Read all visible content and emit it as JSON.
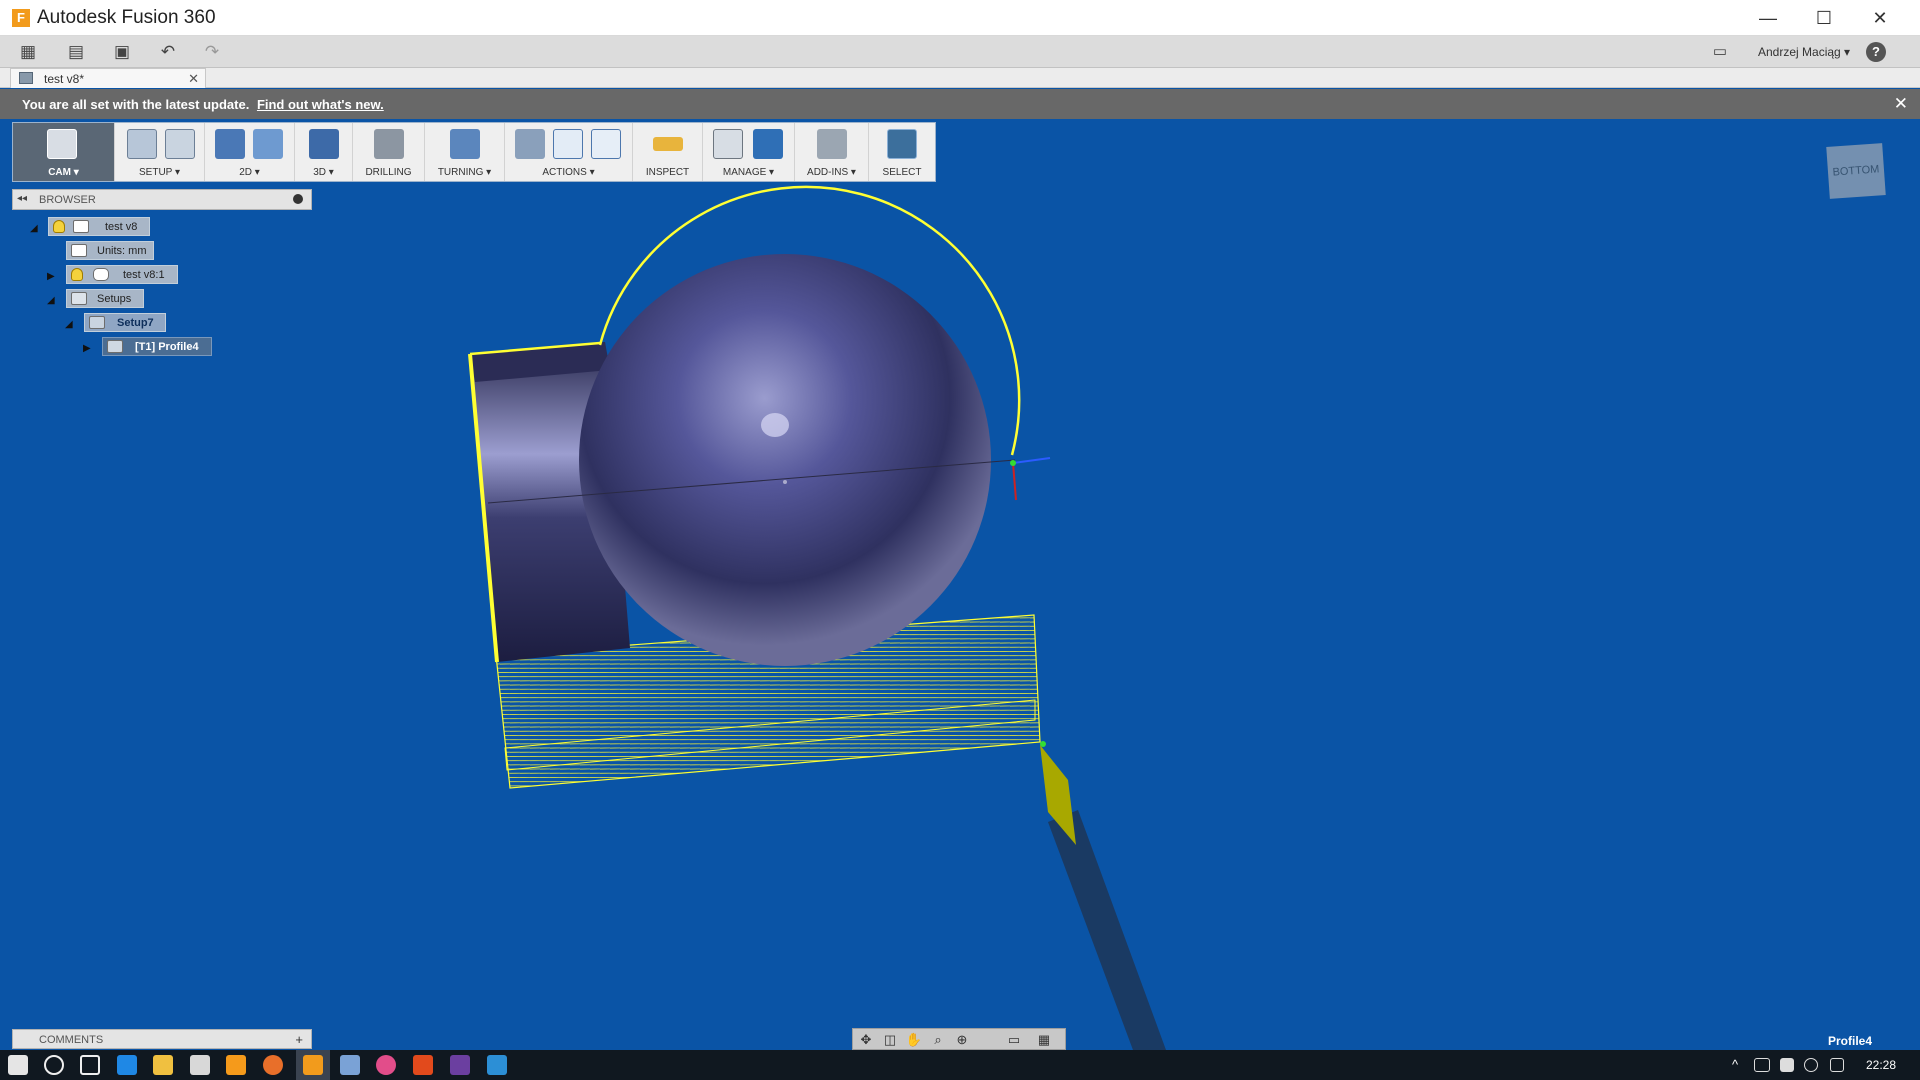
{
  "window": {
    "app_icon_letter": "F",
    "title": "Autodesk Fusion 360",
    "minimize": "—",
    "maximize": "☐",
    "close": "✕"
  },
  "qat": {
    "apps_icon": "▦",
    "file_icon": "▤",
    "save_icon": "▣",
    "undo_icon": "↶",
    "redo_icon": "↷",
    "chat_icon": "▭",
    "user": "Andrzej Maciąg ▾",
    "help_icon": "?"
  },
  "doc_tab": {
    "label": "test v8*",
    "close": "✕"
  },
  "notification": {
    "text": "You are all set with the latest update.",
    "link": "Find out what's new.",
    "close": "✕"
  },
  "ribbon": {
    "workspace": "CAM ▾",
    "setup": "SETUP ▾",
    "two_d": "2D ▾",
    "three_d": "3D ▾",
    "drilling": "DRILLING",
    "turning": "TURNING ▾",
    "actions": "ACTIONS ▾",
    "inspect": "INSPECT",
    "manage": "MANAGE ▾",
    "addins": "ADD-INS ▾",
    "select": "SELECT"
  },
  "browser": {
    "title": "BROWSER",
    "collapse_icon": "◂◂",
    "tree": {
      "root": "test v8",
      "units": "Units: mm",
      "component": "test v8:1",
      "setups": "Setups",
      "setup": "Setup7",
      "operation": "[T1] Profile4"
    },
    "expanded_icon": "◢",
    "collapsed_icon": "▶"
  },
  "viewcube": {
    "label": "BOTTOM"
  },
  "comments": {
    "title": "COMMENTS",
    "add_icon": "+"
  },
  "statusbar": {
    "selection": "Profile4"
  },
  "navbar": {
    "orbit": "✥",
    "look": "◫",
    "pan": "✋",
    "zoom": "⌕",
    "fit": "⊕",
    "display": "▭",
    "grid": "▦"
  },
  "taskbar": {
    "clock": "22:28",
    "tray_arrow": "^"
  },
  "colors": {
    "viewport_bg": "#0a54a6",
    "toolpath": "#ffff33",
    "part": "#3d3d69",
    "tool_insert": "#a8a800"
  }
}
